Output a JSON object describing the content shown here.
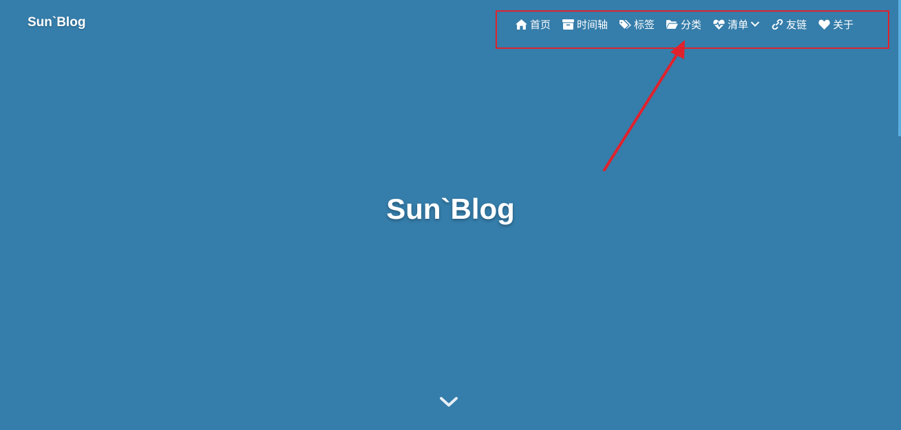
{
  "header": {
    "brand": "Sun`Blog"
  },
  "nav": {
    "items": [
      {
        "label": "首页",
        "icon": "home-icon"
      },
      {
        "label": "时间轴",
        "icon": "archive-icon"
      },
      {
        "label": "标签",
        "icon": "tags-icon"
      },
      {
        "label": "分类",
        "icon": "folder-open-icon"
      },
      {
        "label": "清单",
        "icon": "heartbeat-icon",
        "dropdown": true
      },
      {
        "label": "友链",
        "icon": "link-icon"
      },
      {
        "label": "关于",
        "icon": "heart-icon"
      }
    ]
  },
  "hero": {
    "title": "Sun`Blog"
  },
  "colors": {
    "background": "#357daa",
    "annotation": "#e0222d",
    "text": "#ffffff"
  }
}
